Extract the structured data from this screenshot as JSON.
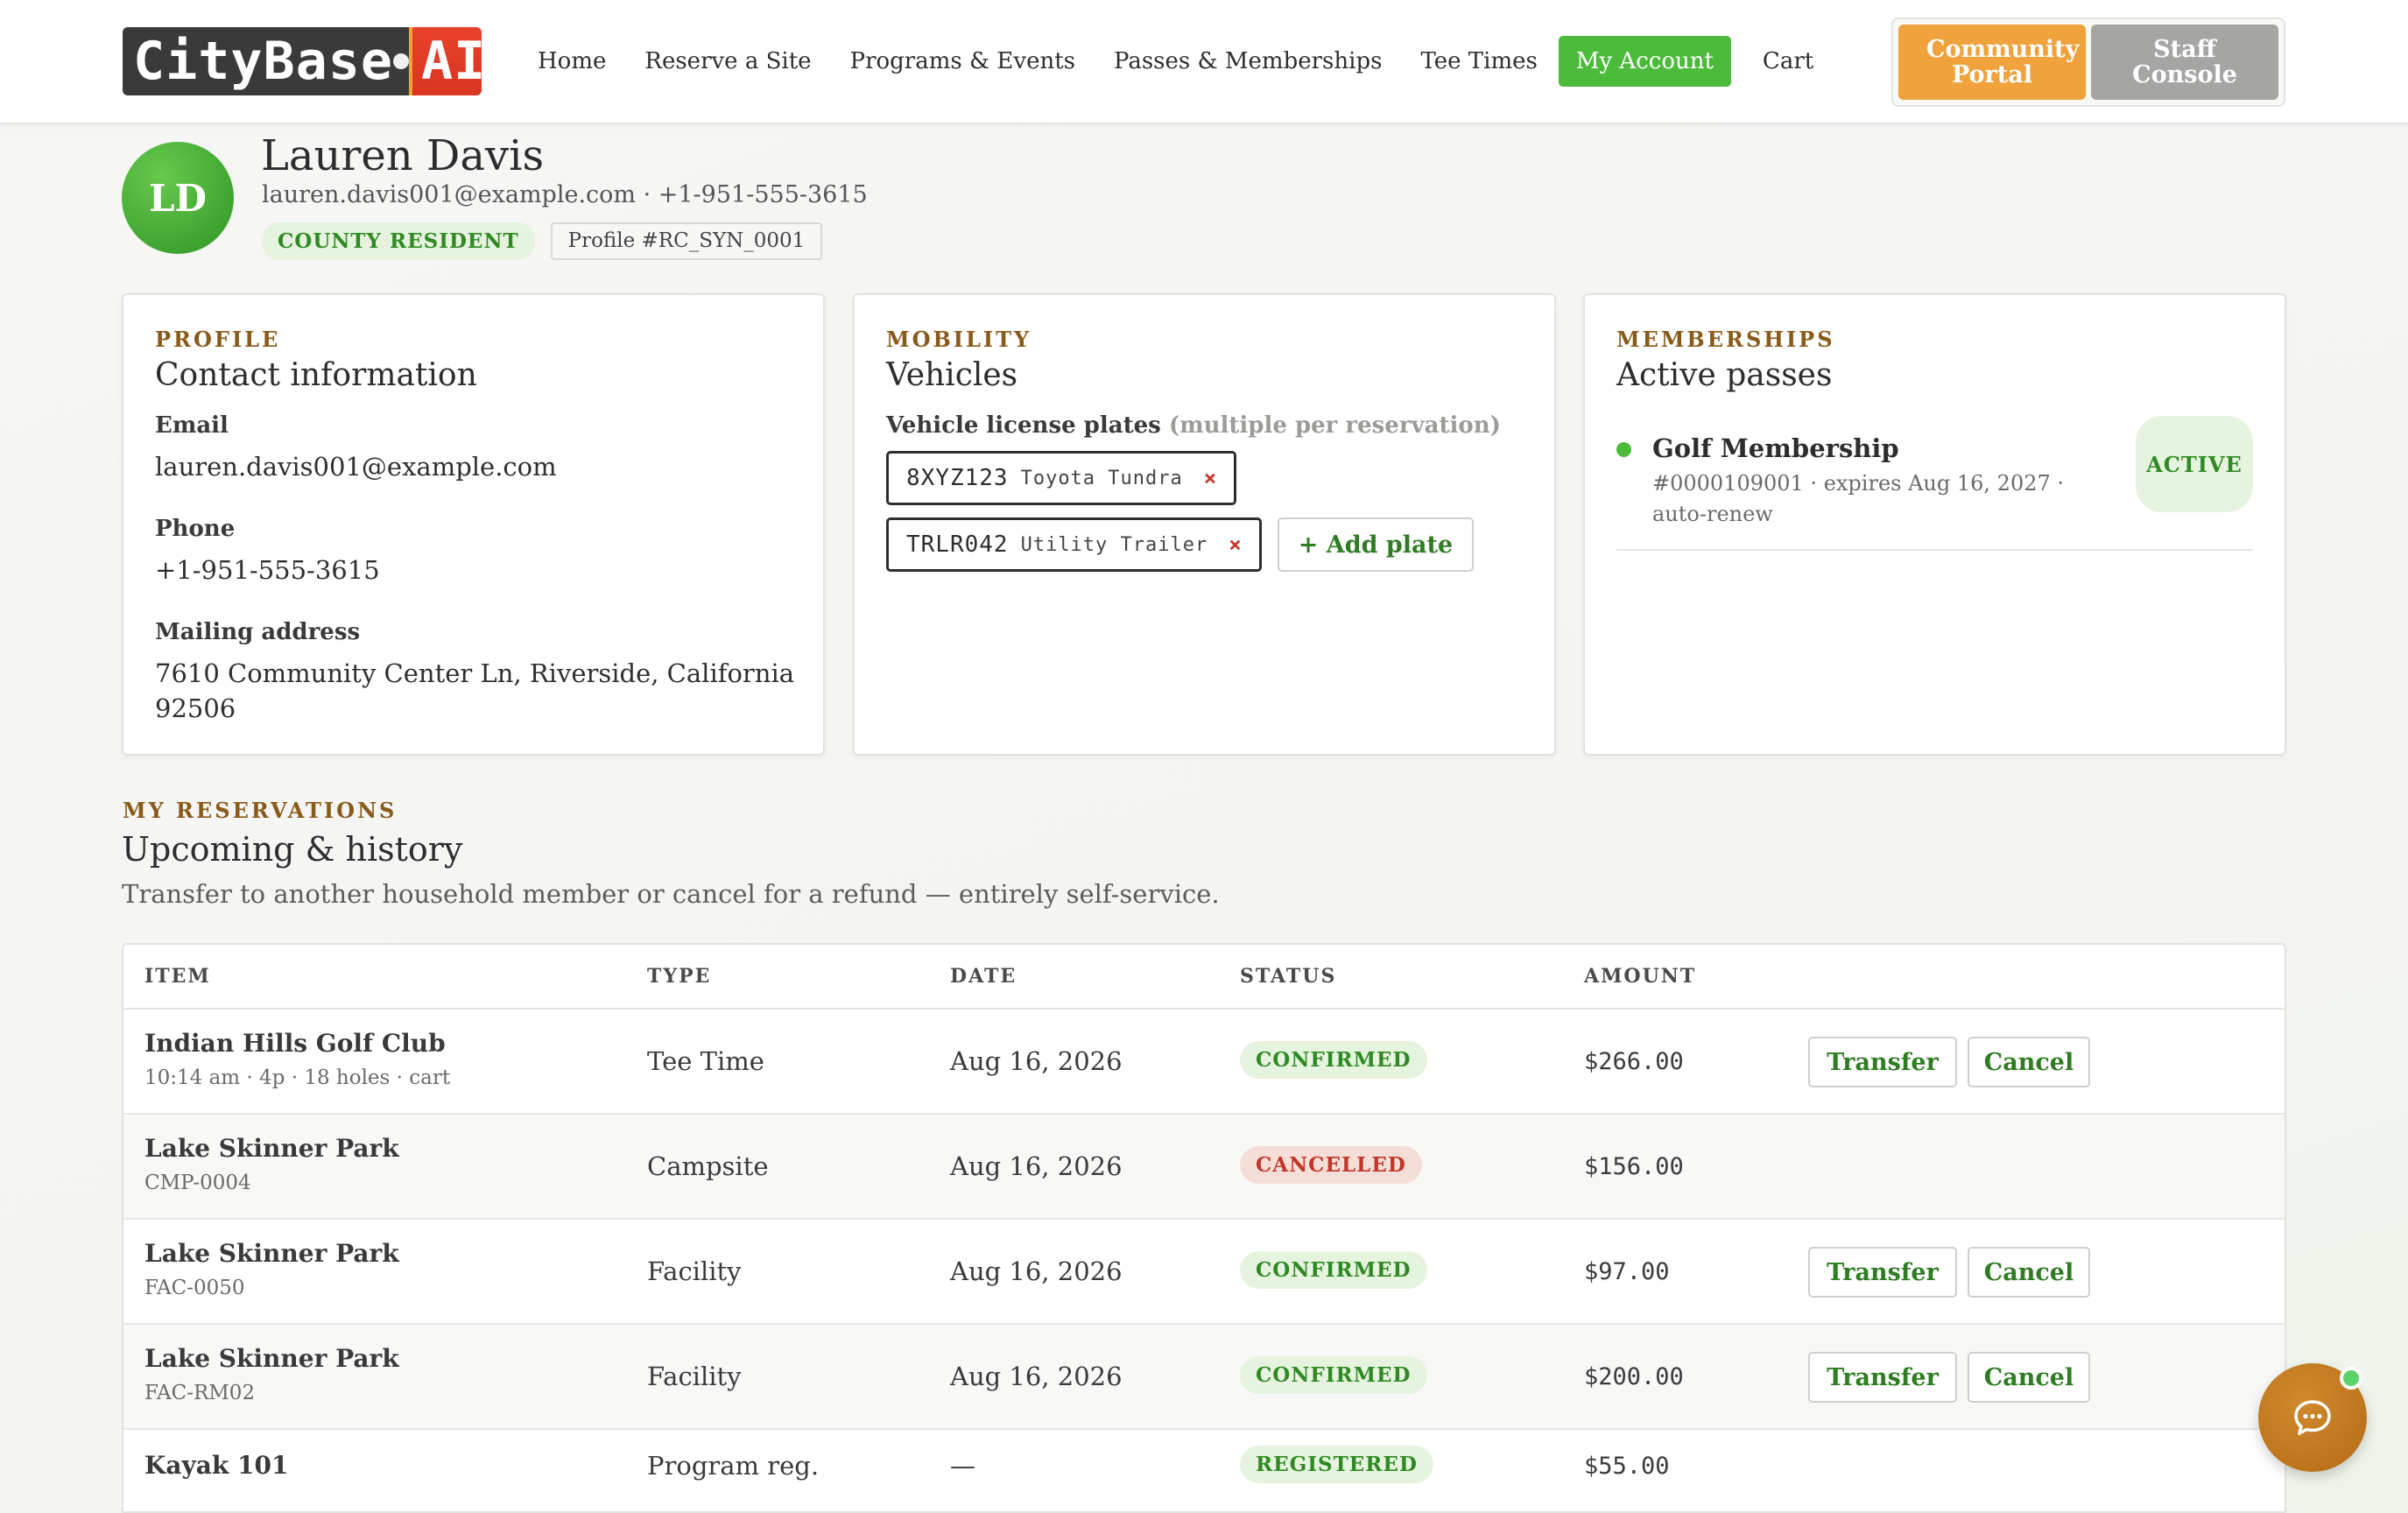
{
  "brand": {
    "logo_left": "CityBase",
    "logo_right": "AI"
  },
  "nav": {
    "items": [
      {
        "label": "Home"
      },
      {
        "label": "Reserve a Site"
      },
      {
        "label": "Programs & Events"
      },
      {
        "label": "Passes & Memberships"
      },
      {
        "label": "Tee Times"
      },
      {
        "label": "My Account",
        "active": true
      },
      {
        "label": "Cart"
      }
    ],
    "community_portal": "Community Portal",
    "staff_console": "Staff Console"
  },
  "profile": {
    "initials": "LD",
    "name": "Lauren Davis",
    "contact_line": "lauren.davis001@example.com · +1-951-555-3615",
    "tag_resident": "COUNTY RESIDENT",
    "tag_profile_id": "Profile #RC_SYN_0001"
  },
  "contact_card": {
    "eyebrow": "PROFILE",
    "title": "Contact information",
    "email_label": "Email",
    "email": "lauren.davis001@example.com",
    "phone_label": "Phone",
    "phone": "+1-951-555-3615",
    "address_label": "Mailing address",
    "address": "7610 Community Center Ln, Riverside, California 92506"
  },
  "vehicles_card": {
    "eyebrow": "MOBILITY",
    "title": "Vehicles",
    "plates_label": "Vehicle license plates",
    "plates_hint": "(multiple per reservation)",
    "plates": [
      {
        "number": "8XYZ123",
        "vehicle": "Toyota Tundra",
        "remove": "×"
      },
      {
        "number": "TRLR042",
        "vehicle": "Utility Trailer",
        "remove": "×"
      }
    ],
    "add_plate": "+ Add plate"
  },
  "memberships_card": {
    "eyebrow": "MEMBERSHIPS",
    "title": "Active passes",
    "items": [
      {
        "name": "Golf Membership",
        "detail": "#0000109001 · expires Aug 16, 2027 · auto-renew",
        "status": "ACTIVE"
      }
    ]
  },
  "reservations": {
    "eyebrow": "MY RESERVATIONS",
    "title": "Upcoming & history",
    "description": "Transfer to another household member or cancel for a refund — entirely self-service.",
    "columns": [
      "ITEM",
      "TYPE",
      "DATE",
      "STATUS",
      "AMOUNT"
    ],
    "transfer_label": "Transfer",
    "cancel_label": "Cancel",
    "rows": [
      {
        "name": "Indian Hills Golf Club",
        "sub": "10:14 am · 4p · 18 holes · cart",
        "type": "Tee Time",
        "date": "Aug 16, 2026",
        "status": "CONFIRMED",
        "amount": "$266.00"
      },
      {
        "name": "Lake Skinner Park",
        "sub": "CMP-0004",
        "type": "Campsite",
        "date": "Aug 16, 2026",
        "status": "CANCELLED",
        "amount": "$156.00"
      },
      {
        "name": "Lake Skinner Park",
        "sub": "FAC-0050",
        "type": "Facility",
        "date": "Aug 16, 2026",
        "status": "CONFIRMED",
        "amount": "$97.00"
      },
      {
        "name": "Lake Skinner Park",
        "sub": "FAC-RM02",
        "type": "Facility",
        "date": "Aug 16, 2026",
        "status": "CONFIRMED",
        "amount": "$200.00"
      },
      {
        "name": "Kayak 101",
        "sub": "",
        "type": "Program reg.",
        "date": "—",
        "status": "REGISTERED",
        "amount": "$55.00"
      }
    ]
  },
  "colors": {
    "accent_green": "#4cbb3c",
    "eyebrow_brown": "#8a5a1a",
    "portal_orange": "#f0a23c",
    "cancel_red": "#c2362a"
  }
}
